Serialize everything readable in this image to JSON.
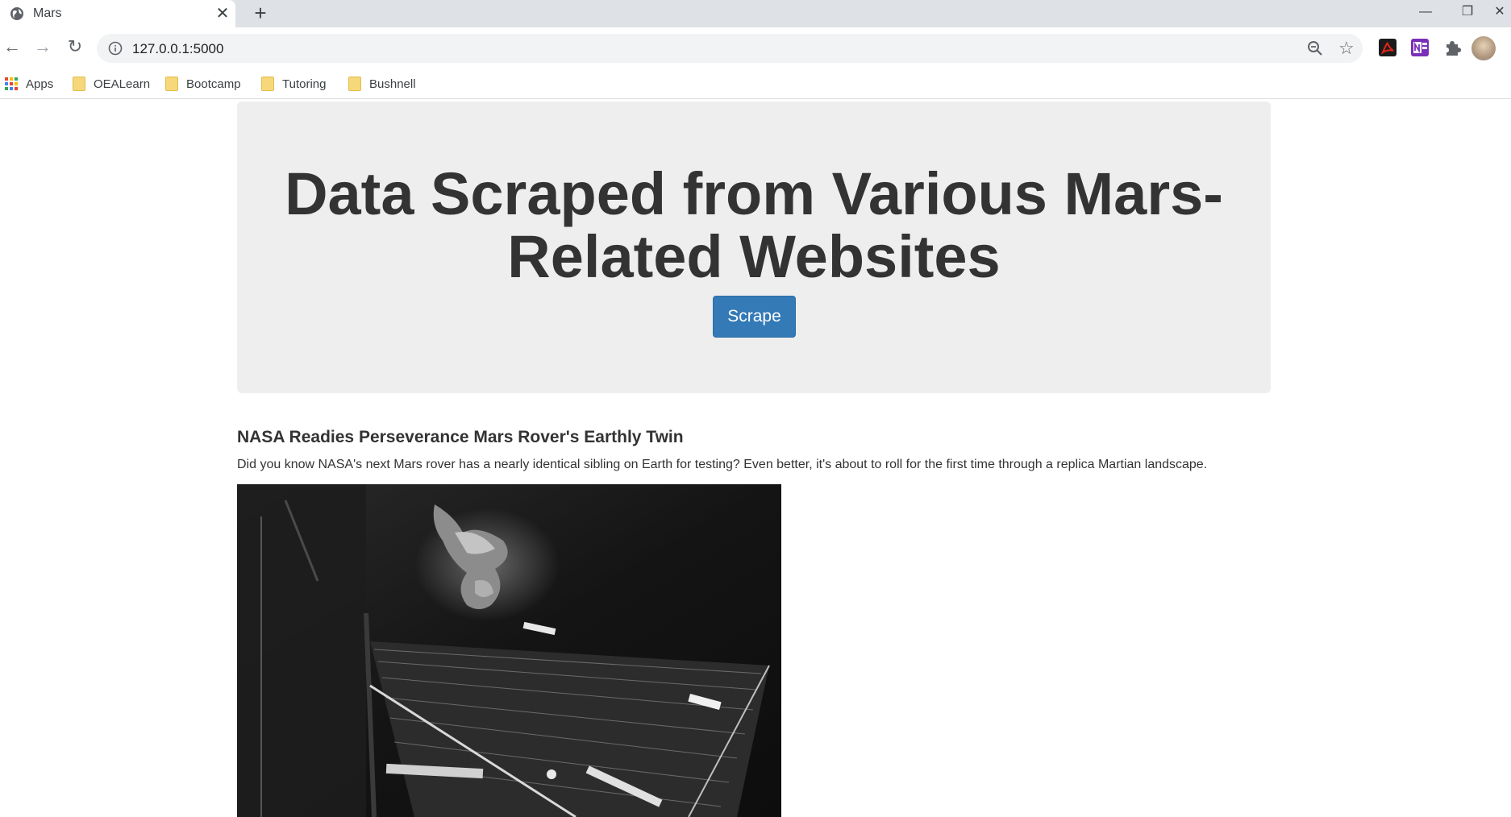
{
  "browser": {
    "tab_title": "Mars",
    "tab_close": "✕",
    "new_tab": "+",
    "url": "127.0.0.1:5000",
    "window_controls": {
      "minimize": "—",
      "restore": "❐",
      "close": "✕"
    },
    "bookmarks": [
      {
        "label": "Apps",
        "icon": "apps-grid-icon"
      },
      {
        "label": "OEALearn",
        "icon": "folder-icon"
      },
      {
        "label": "Bootcamp",
        "icon": "folder-icon"
      },
      {
        "label": "Tutoring",
        "icon": "folder-icon"
      },
      {
        "label": "Bushnell",
        "icon": "folder-icon"
      }
    ],
    "icons": {
      "back": "←",
      "forward": "→",
      "reload": "↻",
      "star": "☆"
    }
  },
  "page": {
    "hero_title": "Data Scraped from Various Mars-Related Websites",
    "scrape_label": "Scrape",
    "news_title": "NASA Readies Perseverance Mars Rover's Earthly Twin",
    "news_paragraph": "Did you know NASA's next Mars rover has a nearly identical sibling on Earth for testing? Even better, it's about to roll for the first time through a replica Martian landscape.",
    "featured_image": "space-image"
  },
  "colors": {
    "primary_button": "#337ab7",
    "jumbotron_bg": "#eeeeee",
    "text": "#333333",
    "tabstrip_bg": "#dee1e6"
  }
}
